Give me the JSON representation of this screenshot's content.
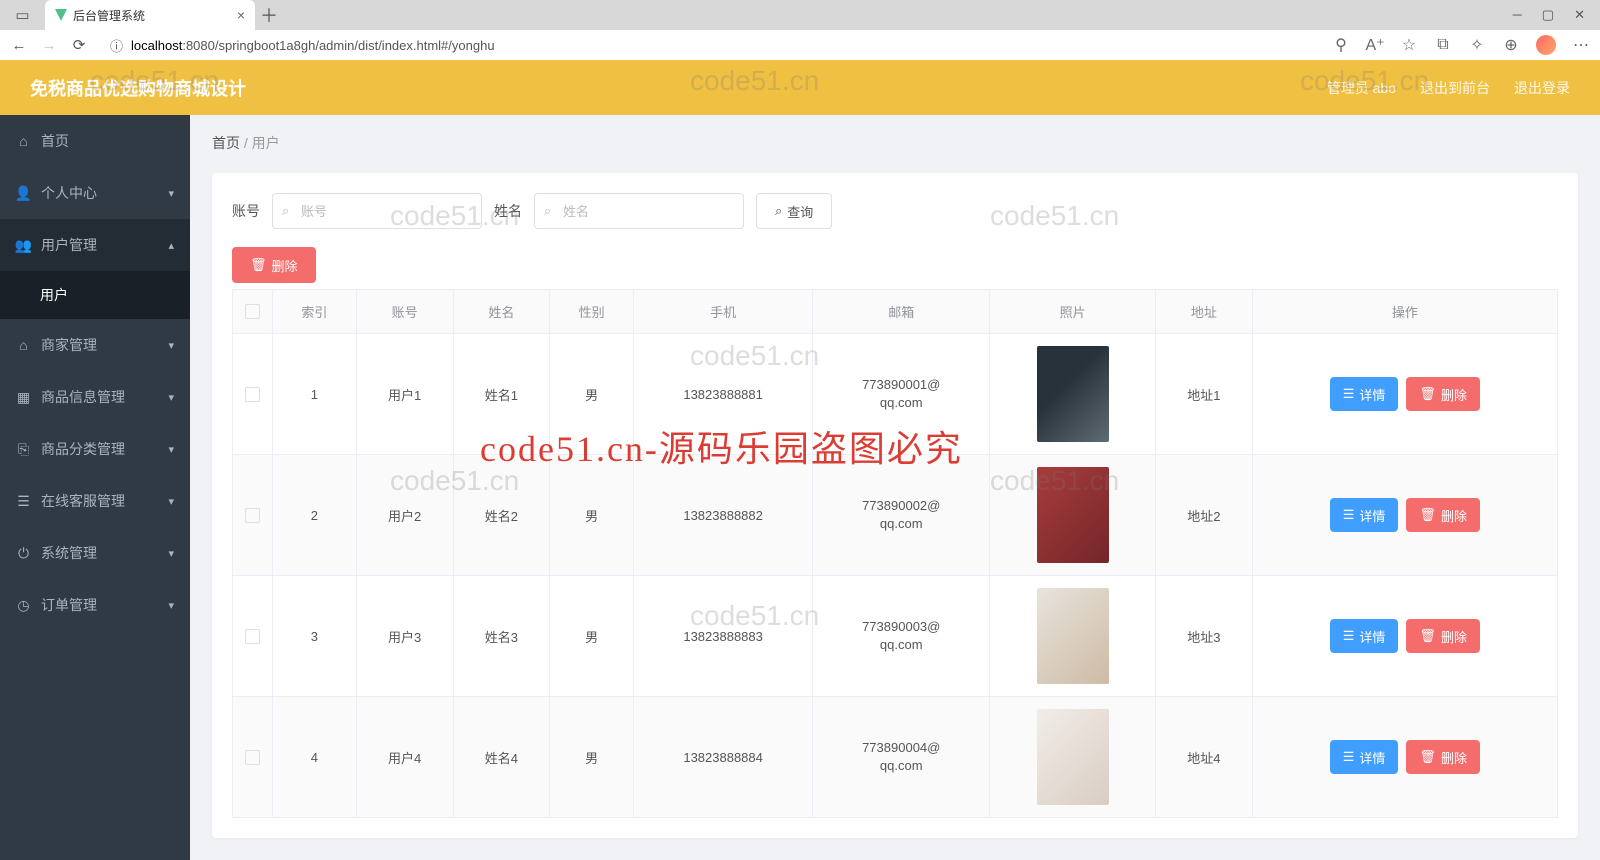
{
  "browser": {
    "tab_title": "后台管理系统",
    "url_host": "localhost",
    "url_path": ":8080/springboot1a8gh/admin/dist/index.html#/yonghu"
  },
  "header": {
    "title": "免税商品优选购物商城设计",
    "admin_label": "管理员 abo",
    "exit_front": "退出到前台",
    "logout": "退出登录"
  },
  "sidebar": {
    "items": [
      {
        "label": "首页",
        "icon": "home",
        "expandable": false
      },
      {
        "label": "个人中心",
        "icon": "user",
        "expandable": true
      },
      {
        "label": "用户管理",
        "icon": "users",
        "expandable": true,
        "open": true,
        "sub": [
          {
            "label": "用户"
          }
        ]
      },
      {
        "label": "商家管理",
        "icon": "store",
        "expandable": true
      },
      {
        "label": "商品信息管理",
        "icon": "grid",
        "expandable": true
      },
      {
        "label": "商品分类管理",
        "icon": "copy",
        "expandable": true
      },
      {
        "label": "在线客服管理",
        "icon": "list",
        "expandable": true
      },
      {
        "label": "系统管理",
        "icon": "power",
        "expandable": true
      },
      {
        "label": "订单管理",
        "icon": "clock",
        "expandable": true
      }
    ]
  },
  "breadcrumb": {
    "home": "首页",
    "sep": "/",
    "current": "用户"
  },
  "search": {
    "account_label": "账号",
    "account_placeholder": "账号",
    "name_label": "姓名",
    "name_placeholder": "姓名",
    "query_btn": "查询"
  },
  "toolbar": {
    "delete_btn": "删除"
  },
  "table": {
    "columns": [
      "索引",
      "账号",
      "姓名",
      "性别",
      "手机",
      "邮箱",
      "照片",
      "地址",
      "操作"
    ],
    "detail_btn": "详情",
    "delete_btn": "删除",
    "rows": [
      {
        "idx": "1",
        "account": "用户1",
        "name": "姓名1",
        "gender": "男",
        "phone": "13823888881",
        "email": "773890001@qq.com",
        "address": "地址1",
        "thumb": "t1"
      },
      {
        "idx": "2",
        "account": "用户2",
        "name": "姓名2",
        "gender": "男",
        "phone": "13823888882",
        "email": "773890002@qq.com",
        "address": "地址2",
        "thumb": "t2"
      },
      {
        "idx": "3",
        "account": "用户3",
        "name": "姓名3",
        "gender": "男",
        "phone": "13823888883",
        "email": "773890003@qq.com",
        "address": "地址3",
        "thumb": "t3"
      },
      {
        "idx": "4",
        "account": "用户4",
        "name": "姓名4",
        "gender": "男",
        "phone": "13823888884",
        "email": "773890004@qq.com",
        "address": "地址4",
        "thumb": "t4"
      }
    ]
  },
  "watermarks": [
    "code51.cn",
    "code51.cn",
    "code51.cn",
    "code51.cn",
    "code51.cn",
    "code51.cn",
    "code51.cn",
    "code51.cn",
    "code51.cn"
  ],
  "watermark_red": "code51.cn-源码乐园盗图必究"
}
